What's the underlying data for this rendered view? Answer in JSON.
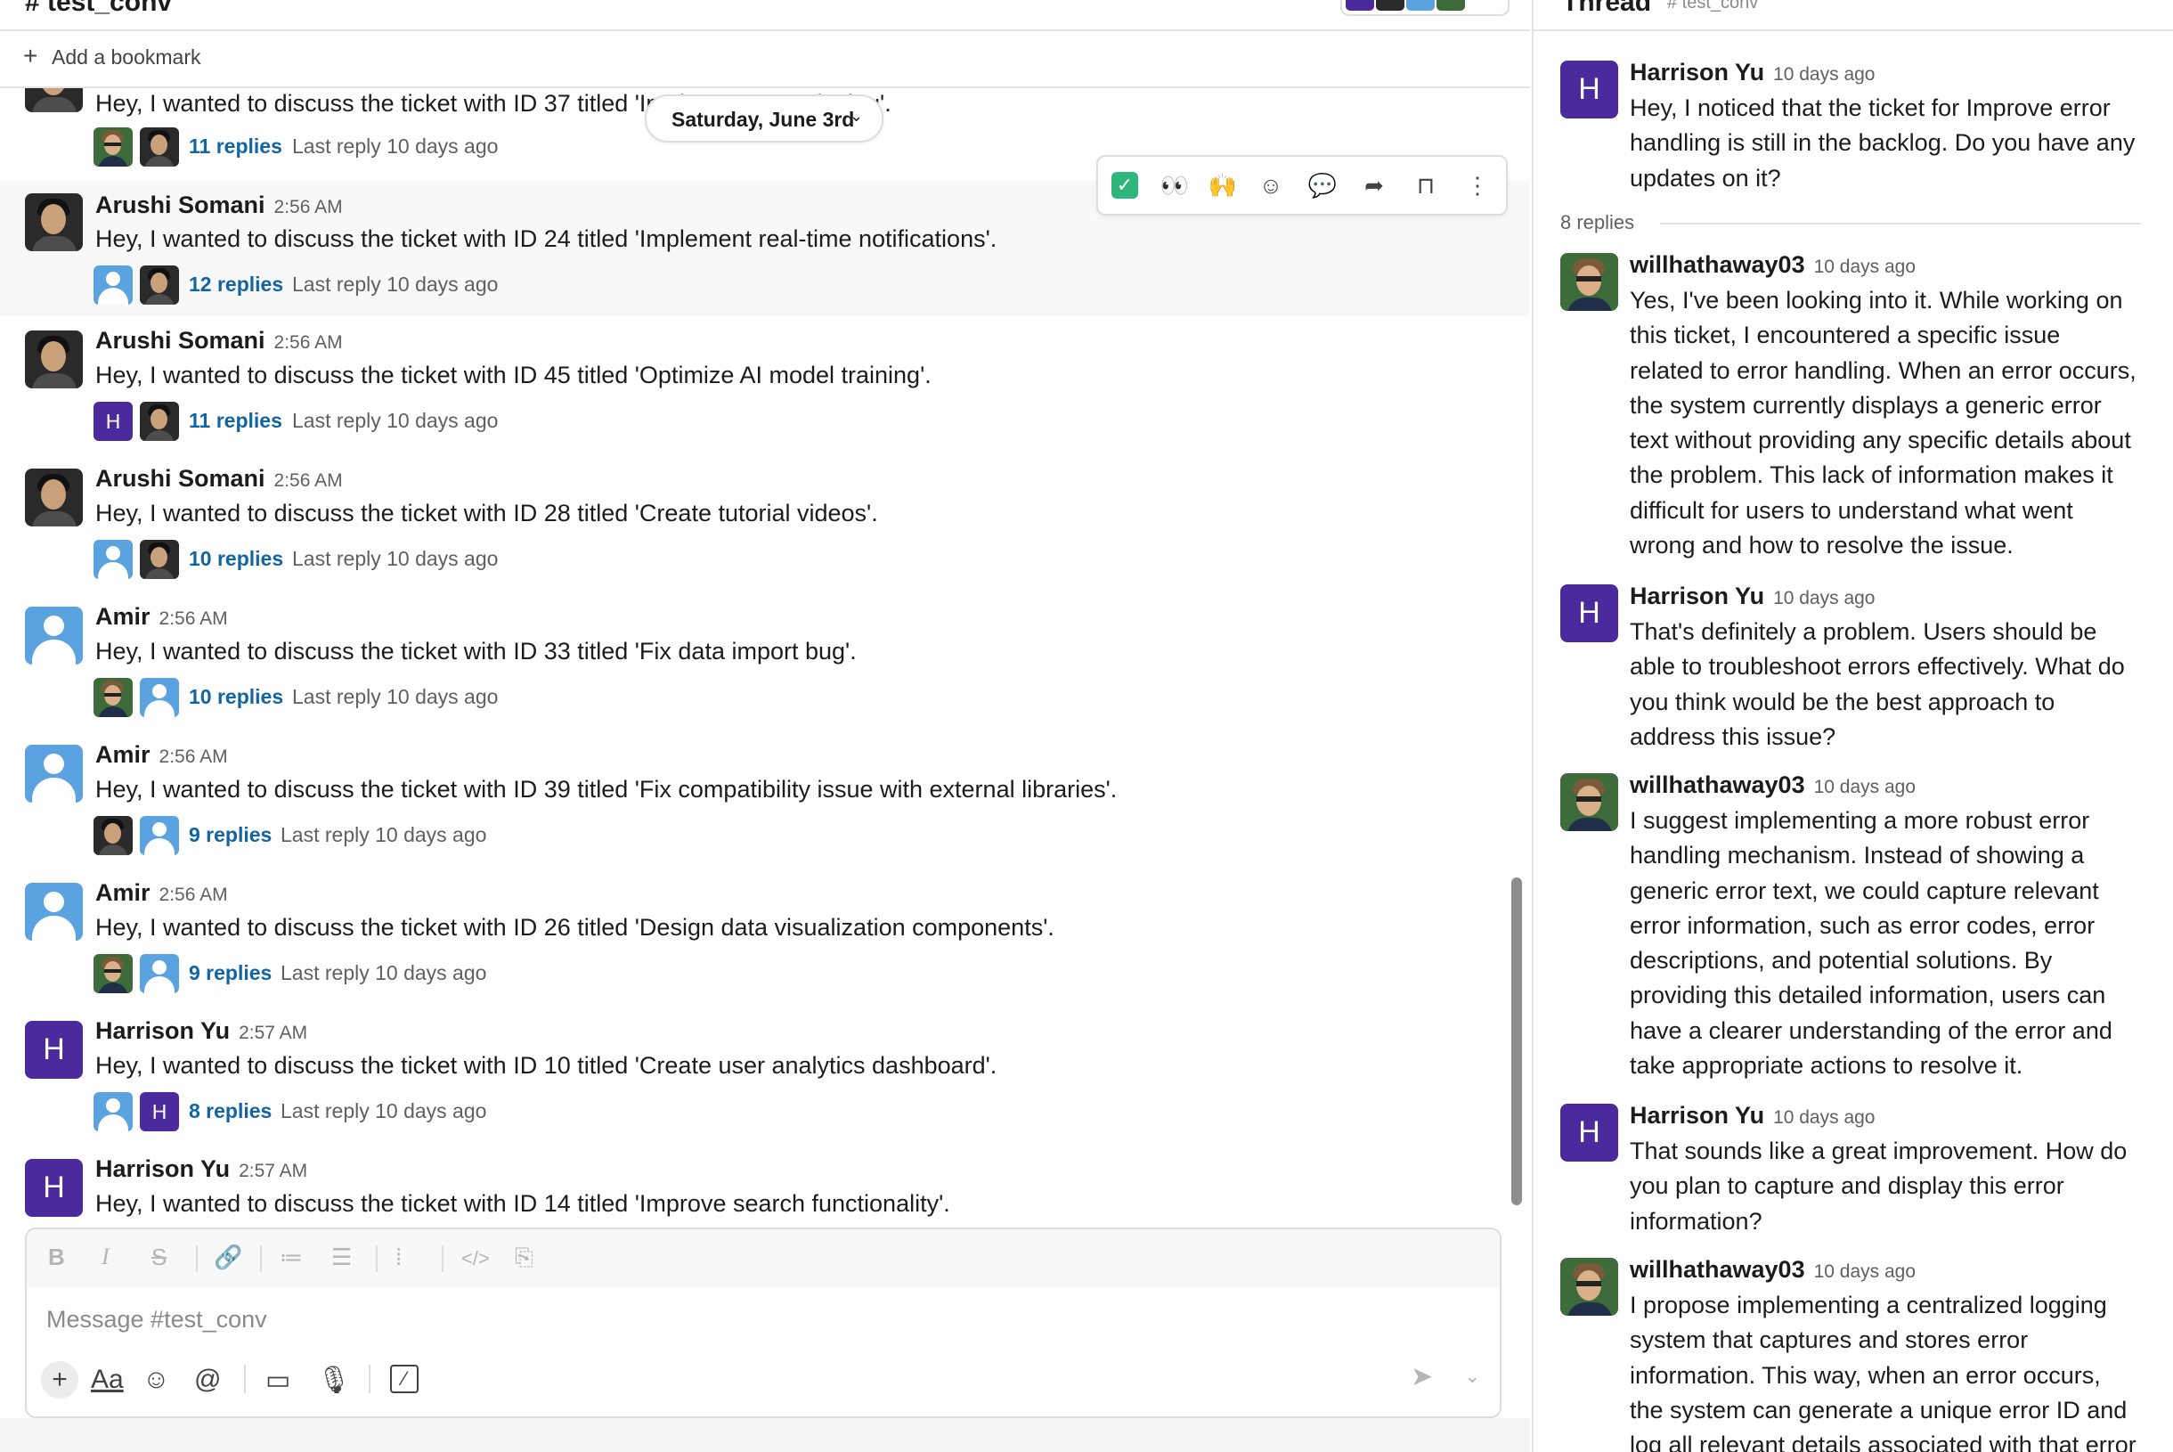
{
  "channel": {
    "title": "# test_conv",
    "bookmark_label": "Add a bookmark"
  },
  "date_divider": "Saturday, June 3rd",
  "messages": [
    {
      "author": "",
      "time": "",
      "text": "Hey, I wanted to discuss the ticket with ID 37 titled 'Implement security log'.",
      "replies": "11 replies",
      "last_reply": "Last reply 10 days ago"
    },
    {
      "author": "Arushi Somani",
      "time": "2:56 AM",
      "text": "Hey, I wanted to discuss the ticket with ID 24 titled 'Implement real-time notifications'.",
      "replies": "12 replies",
      "last_reply": "Last reply 10 days ago"
    },
    {
      "author": "Arushi Somani",
      "time": "2:56 AM",
      "text": "Hey, I wanted to discuss the ticket with ID 45 titled 'Optimize AI model training'.",
      "replies": "11 replies",
      "last_reply": "Last reply 10 days ago"
    },
    {
      "author": "Arushi Somani",
      "time": "2:56 AM",
      "text": "Hey, I wanted to discuss the ticket with ID 28 titled 'Create tutorial videos'.",
      "replies": "10 replies",
      "last_reply": "Last reply 10 days ago"
    },
    {
      "author": "Amir",
      "time": "2:56 AM",
      "text": "Hey, I wanted to discuss the ticket with ID 33 titled 'Fix data import bug'.",
      "replies": "10 replies",
      "last_reply": "Last reply 10 days ago"
    },
    {
      "author": "Amir",
      "time": "2:56 AM",
      "text": "Hey, I wanted to discuss the ticket with ID 39 titled 'Fix compatibility issue with external libraries'.",
      "replies": "9 replies",
      "last_reply": "Last reply 10 days ago"
    },
    {
      "author": "Amir",
      "time": "2:56 AM",
      "text": "Hey, I wanted to discuss the ticket with ID 26 titled 'Design data visualization components'.",
      "replies": "9 replies",
      "last_reply": "Last reply 10 days ago"
    },
    {
      "author": "Harrison Yu",
      "time": "2:57 AM",
      "text": "Hey, I wanted to discuss the ticket with ID 10 titled 'Create user analytics dashboard'.",
      "replies": "8 replies",
      "last_reply": "Last reply 10 days ago"
    },
    {
      "author": "Harrison Yu",
      "time": "2:57 AM",
      "text": "Hey, I wanted to discuss the ticket with ID 14 titled 'Improve search functionality'.",
      "replies": "",
      "last_reply": ""
    }
  ],
  "hover_actions": {
    "check": "✓",
    "eyes": "👀",
    "raised_hands": "🙌",
    "add_reaction": "☺",
    "reply_thread": "💬",
    "forward": "➦",
    "bookmark": "⊓",
    "more": "⋮"
  },
  "composer": {
    "placeholder": "Message #test_conv",
    "format_bold": "B",
    "format_italic": "I",
    "format_strike": "S",
    "format_link": "🔗",
    "format_ordered": "≔",
    "format_bullet": "☰",
    "format_quote": "⁞",
    "format_code": "</>",
    "format_codeblock": "⎘",
    "tool_plus": "+",
    "tool_text": "Aa",
    "tool_emoji": "☺",
    "tool_mention": "@",
    "tool_video": "▭",
    "tool_audio": "🎙",
    "tool_slash": "⁄",
    "send": "➤",
    "send_options": "⌄"
  },
  "avatar_letters": {
    "harrison": "H"
  },
  "thread": {
    "title": "Thread",
    "subtitle": "# test_conv",
    "replies_count": "8 replies",
    "messages": [
      {
        "author": "Harrison Yu",
        "time": "10 days ago",
        "text": "Hey, I noticed that the ticket for Improve error handling is still in the backlog. Do you have any updates on it?"
      },
      {
        "author": "willhathaway03",
        "time": "10 days ago",
        "text": "Yes, I've been looking into it. While working on this ticket, I encountered a specific issue related to error handling. When an error occurs, the system currently displays a generic error text without providing any specific details about the problem. This lack of information makes it difficult for users to understand what went wrong and how to resolve the issue."
      },
      {
        "author": "Harrison Yu",
        "time": "10 days ago",
        "text": "That's definitely a problem. Users should be able to troubleshoot errors effectively. What do you think would be the best approach to address this issue?"
      },
      {
        "author": "willhathaway03",
        "time": "10 days ago",
        "text": "I suggest implementing a more robust error handling mechanism. Instead of showing a generic error text, we could capture relevant error information, such as error codes, error descriptions, and potential solutions. By providing this detailed information, users can have a clearer understanding of the error and take appropriate actions to resolve it."
      },
      {
        "author": "Harrison Yu",
        "time": "10 days ago",
        "text": "That sounds like a great improvement. How do you plan to capture and display this error information?"
      },
      {
        "author": "willhathaway03",
        "time": "10 days ago",
        "text": "I propose implementing a centralized logging system that captures and stores error information. This way, when an error occurs, the system can generate a unique error ID and log all relevant details associated with that error"
      }
    ]
  },
  "colors": {
    "link": "#1264a3",
    "avatar_h": "#4a2a9c",
    "avatar_generic": "#5aa3e0",
    "check": "#2eb67d"
  }
}
